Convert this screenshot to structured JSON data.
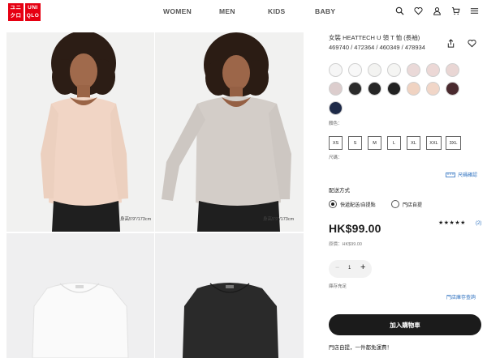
{
  "brand": {
    "logo_left_top": "ユニ",
    "logo_left_bottom": "クロ",
    "logo_right_top": "UNI",
    "logo_right_bottom": "QLO",
    "color": "#e60012"
  },
  "nav": {
    "items": [
      {
        "label": "WOMEN"
      },
      {
        "label": "MEN"
      },
      {
        "label": "KIDS"
      },
      {
        "label": "BABY"
      }
    ]
  },
  "header_icons": [
    "search-icon",
    "heart-icon",
    "user-icon",
    "cart-icon",
    "menu-icon"
  ],
  "gallery": {
    "captions": [
      "身高5'9\"/173cm",
      "身高5'9\"/173cm"
    ]
  },
  "product": {
    "title": "女裝 HEATTECH U 領 T 恤 (長袖) 469740 / 472364 / 460349 / 478934",
    "color_label": "顏色：",
    "colors": [
      {
        "name": "white-1",
        "hex": "#f6f6f6"
      },
      {
        "name": "white-2",
        "hex": "#f8f8f8"
      },
      {
        "name": "offwhite-1",
        "hex": "#f3f3f1"
      },
      {
        "name": "offwhite-2",
        "hex": "#f5f5f3"
      },
      {
        "name": "pink-1",
        "hex": "#ead9d8"
      },
      {
        "name": "pink-2",
        "hex": "#ecd8d6"
      },
      {
        "name": "pink-3",
        "hex": "#e9d6d4"
      },
      {
        "name": "pink-4",
        "hex": "#dccdcd"
      },
      {
        "name": "black-1",
        "hex": "#2b2b2b"
      },
      {
        "name": "black-2",
        "hex": "#252525"
      },
      {
        "name": "black-3",
        "hex": "#222222"
      },
      {
        "name": "beige-1",
        "hex": "#f0d3c2"
      },
      {
        "name": "beige-2",
        "hex": "#f1d6c8"
      },
      {
        "name": "burgundy",
        "hex": "#4a2a2e"
      },
      {
        "name": "navy",
        "hex": "#1e2a48"
      }
    ],
    "sizes": [
      "XS",
      "S",
      "M",
      "L",
      "XL",
      "XXL",
      "3XL"
    ],
    "size_label": "尺碼：",
    "size_guide": "尺碼確認",
    "delivery_heading": "配送方式",
    "delivery_options": [
      {
        "label": "快遞配送/自提點",
        "selected": true
      },
      {
        "label": "門店自提",
        "selected": false
      }
    ],
    "price": "HK$99.00",
    "original_price": "原價：HK$99.00",
    "rating_stars": "★★★★★",
    "review_count": "(2)",
    "quantity": "1",
    "stock_label": "庫存充足",
    "store_stock_link": "門店庫存查詢",
    "add_to_cart": "加入購物車",
    "promo": "門店自提，一件都免運費！"
  }
}
